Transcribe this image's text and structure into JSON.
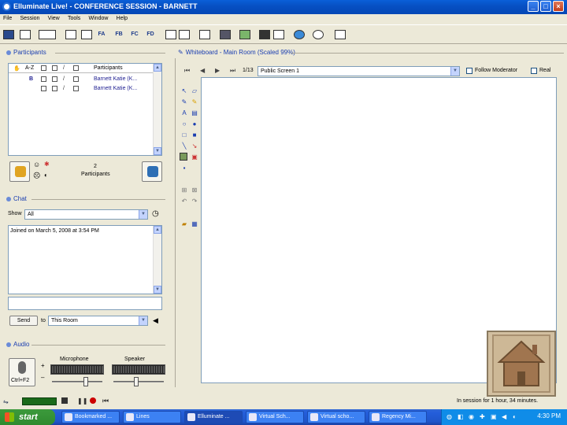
{
  "window": {
    "title": "Elluminate Live! - CONFERENCE SESSION - BARNETT"
  },
  "menu": [
    "File",
    "Session",
    "View",
    "Tools",
    "Window",
    "Help"
  ],
  "toolbar": {
    "labels": [
      "FA",
      "FB",
      "FC",
      "FD"
    ]
  },
  "participants": {
    "title": "Participants",
    "header": {
      "sort": "A-Z",
      "column": "Participants"
    },
    "rows": [
      {
        "mark": "B",
        "name": "Barnett Katie (K..."
      },
      {
        "mark": "",
        "name": "Barnett Katie (K..."
      }
    ],
    "count": "2",
    "count_label": "Participants"
  },
  "chat": {
    "title": "Chat",
    "show_label": "Show",
    "show_value": "All",
    "messages": [
      "Joined on March 5, 2008 at 3:54 PM"
    ],
    "send_label": "Send",
    "to_label": "to",
    "to_value": "This Room"
  },
  "audio": {
    "title": "Audio",
    "mic_button": "Ctrl+F2",
    "microphone_label": "Microphone",
    "speaker_label": "Speaker",
    "plus": "+",
    "minus": "–"
  },
  "whiteboard": {
    "title": "Whiteboard - Main Room (Scaled 99%)",
    "page": "1/13",
    "screen_value": "Public Screen 1",
    "follow_label": "Follow Moderator",
    "other_label": "Real"
  },
  "status": {
    "text": "In session for 1 hour, 34 minutes."
  },
  "taskbar": {
    "start": "start",
    "tasks": [
      "Bookmarked ...",
      "Lines",
      "Elluminate ...",
      "Virtual Sch...",
      "Virtual scho...",
      "Regency Mi..."
    ],
    "clock": "4:30 PM"
  }
}
